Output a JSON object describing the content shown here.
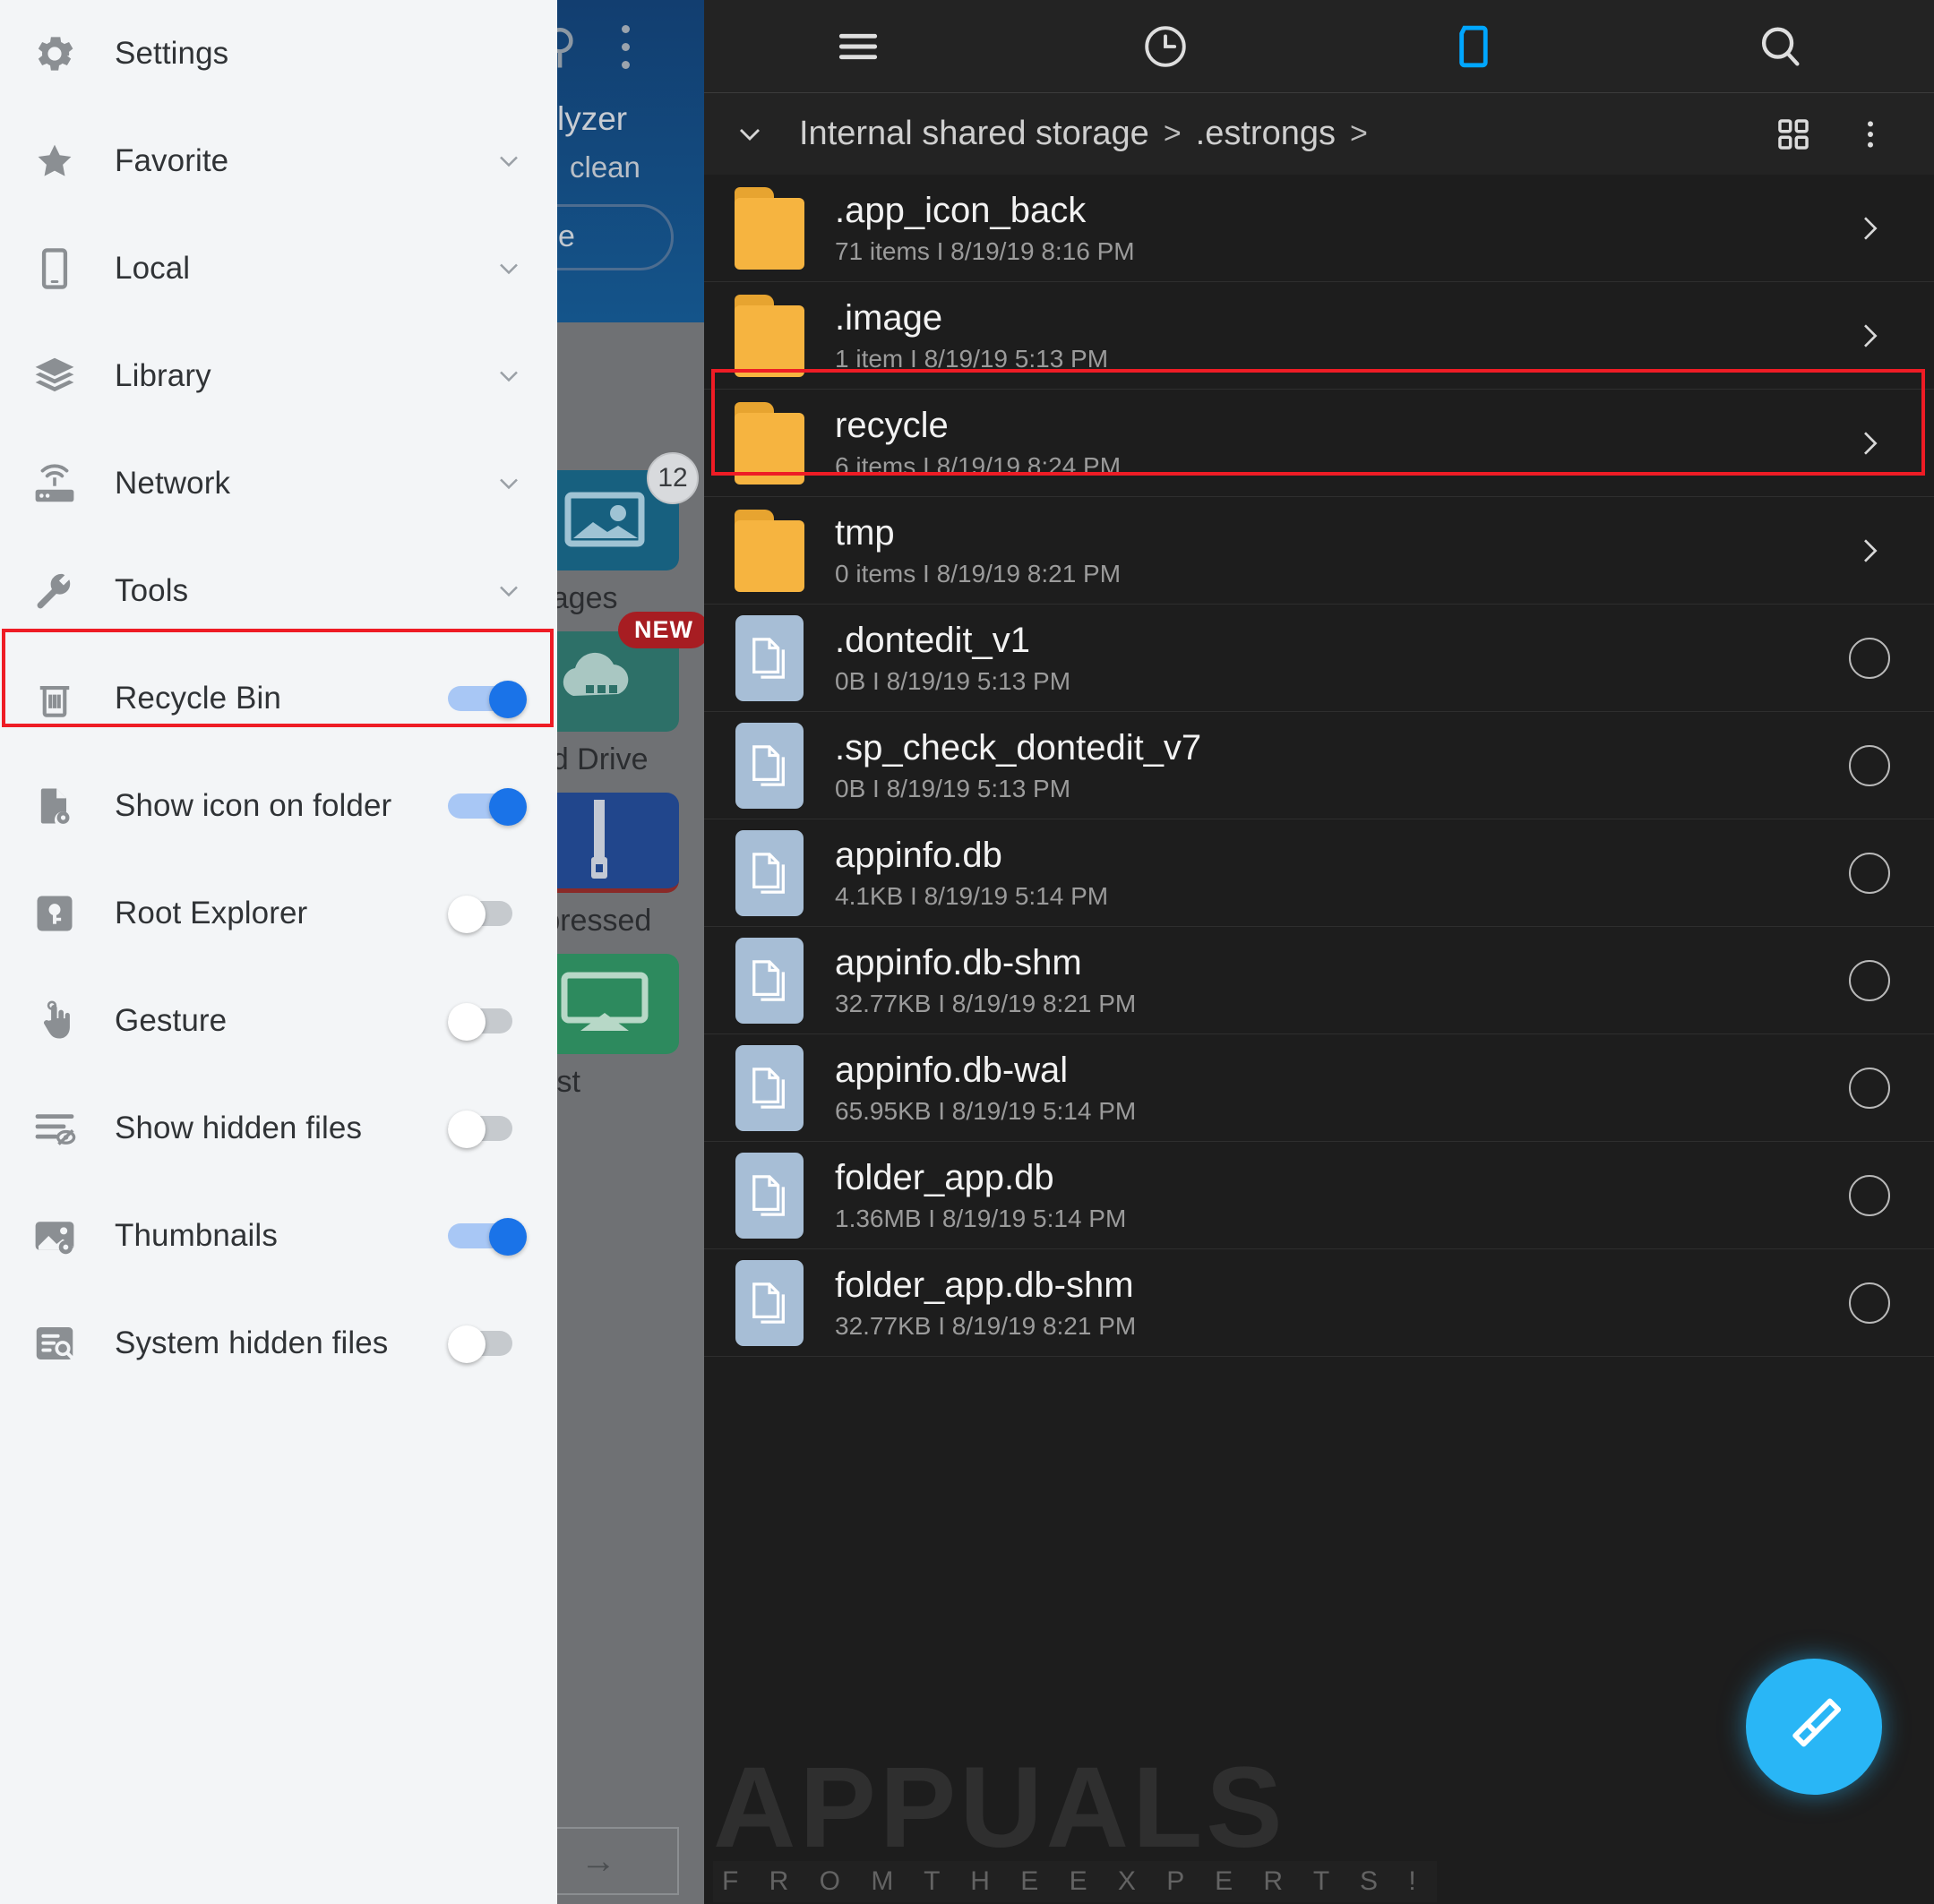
{
  "sidebar": {
    "items": [
      {
        "label": "Settings",
        "icon": "gear-icon",
        "control": "none"
      },
      {
        "label": "Favorite",
        "icon": "star-icon",
        "control": "chevron"
      },
      {
        "label": "Local",
        "icon": "phone-icon",
        "control": "chevron"
      },
      {
        "label": "Library",
        "icon": "layers-icon",
        "control": "chevron"
      },
      {
        "label": "Network",
        "icon": "router-icon",
        "control": "chevron"
      },
      {
        "label": "Tools",
        "icon": "wrench-icon",
        "control": "chevron"
      },
      {
        "label": "Recycle Bin",
        "icon": "trash-icon",
        "control": "toggle",
        "on": true,
        "highlighted": true
      },
      {
        "label": "Show icon on folder",
        "icon": "file-eye-icon",
        "control": "toggle",
        "on": true
      },
      {
        "label": "Root Explorer",
        "icon": "root-key-icon",
        "control": "toggle",
        "on": false
      },
      {
        "label": "Gesture",
        "icon": "hand-tap-icon",
        "control": "toggle",
        "on": false
      },
      {
        "label": "Show hidden files",
        "icon": "lines-eye-off-icon",
        "control": "toggle",
        "on": false
      },
      {
        "label": "Thumbnails",
        "icon": "image-eye-icon",
        "control": "toggle",
        "on": true
      },
      {
        "label": "System hidden files",
        "icon": "list-search-icon",
        "control": "toggle",
        "on": false
      }
    ]
  },
  "middle_panel": {
    "title": "lyzer",
    "subtitle": "clean",
    "button_label": "e",
    "tiles": [
      {
        "label": "Images",
        "badge": "12",
        "badge_type": "count"
      },
      {
        "label": "oud Drive",
        "badge": "NEW",
        "badge_type": "new"
      },
      {
        "label": "mpressed",
        "badge": "",
        "badge_type": "none"
      },
      {
        "label": "Cast",
        "badge": "",
        "badge_type": "none"
      }
    ]
  },
  "explorer": {
    "toolbar": [
      {
        "name": "menu-icon",
        "label": "Menu"
      },
      {
        "name": "history-icon",
        "label": "History"
      },
      {
        "name": "folder-icon",
        "label": "Folder",
        "active": true
      },
      {
        "name": "search-icon",
        "label": "Search"
      }
    ],
    "breadcrumb": {
      "parts": [
        "Internal shared storage",
        ".estrongs"
      ],
      "separator": ">"
    },
    "files": [
      {
        "name": ".app_icon_back",
        "detail": "71 items I 8/19/19 8:16 PM",
        "type": "folder",
        "end": "chevron"
      },
      {
        "name": ".image",
        "detail": "1 item I 8/19/19 5:13 PM",
        "type": "folder",
        "end": "chevron"
      },
      {
        "name": "recycle",
        "detail": "6 items I 8/19/19 8:24 PM",
        "type": "folder",
        "end": "chevron",
        "highlighted": true
      },
      {
        "name": "tmp",
        "detail": "0 items I 8/19/19 8:21 PM",
        "type": "folder",
        "end": "chevron"
      },
      {
        "name": ".dontedit_v1",
        "detail": "0B I 8/19/19 5:13 PM",
        "type": "file",
        "end": "circle"
      },
      {
        "name": ".sp_check_dontedit_v7",
        "detail": "0B I 8/19/19 5:13 PM",
        "type": "file",
        "end": "circle"
      },
      {
        "name": "appinfo.db",
        "detail": "4.1KB I 8/19/19 5:14 PM",
        "type": "file",
        "end": "circle"
      },
      {
        "name": "appinfo.db-shm",
        "detail": "32.77KB I 8/19/19 8:21 PM",
        "type": "file",
        "end": "circle"
      },
      {
        "name": "appinfo.db-wal",
        "detail": "65.95KB I 8/19/19 5:14 PM",
        "type": "file",
        "end": "circle"
      },
      {
        "name": "folder_app.db",
        "detail": "1.36MB I 8/19/19 5:14 PM",
        "type": "file",
        "end": "circle"
      },
      {
        "name": "folder_app.db-shm",
        "detail": "32.77KB I 8/19/19 8:21 PM",
        "type": "file",
        "end": "circle"
      }
    ],
    "fab": {
      "icon": "brush-icon",
      "label": "Clean"
    }
  },
  "watermark": {
    "title": "APPUALS",
    "tagline": "F R O M   T H E   E X P E R T S !"
  },
  "colors": {
    "accent_blue": "#1a73e8",
    "fab_blue": "#29b6f6",
    "folder_orange": "#f6b440",
    "highlight_red": "#ee1c25",
    "file_icon_blue": "#a7bed6"
  }
}
